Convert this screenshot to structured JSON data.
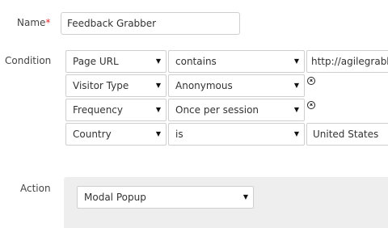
{
  "form": {
    "name": {
      "label": "Name",
      "required_mark": "*",
      "value": "Feedback Grabber"
    },
    "condition": {
      "label": "Condition",
      "rows": [
        {
          "field": "Page URL",
          "operator": "contains",
          "value": "http://agilegrabbe",
          "removable": false
        },
        {
          "field": "Visitor Type",
          "operator": "Anonymous",
          "removable": true
        },
        {
          "field": "Frequency",
          "operator": "Once per session",
          "removable": true
        },
        {
          "field": "Country",
          "operator": "is",
          "value": "United States",
          "removable": false
        }
      ]
    },
    "action": {
      "label": "Action",
      "selected": "Modal Popup"
    }
  },
  "icons": {
    "dropdown": "chevron-down-icon",
    "remove": "remove-circle-icon"
  },
  "colors": {
    "required": "#e1282f",
    "border": "#cfcfcf",
    "panel_bg": "#eeeeee"
  }
}
